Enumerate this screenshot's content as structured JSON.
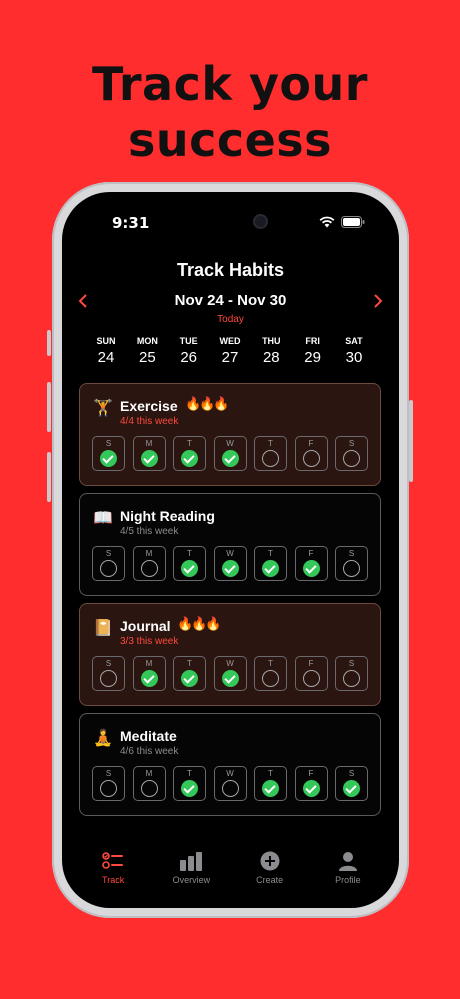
{
  "headline": {
    "line1": "Track your",
    "line2": "success"
  },
  "status": {
    "time": "9:31"
  },
  "screen_title": "Track Habits",
  "week": {
    "range": "Nov 24 - Nov 30",
    "today_label": "Today"
  },
  "days": [
    {
      "name": "SUN",
      "num": "24"
    },
    {
      "name": "MON",
      "num": "25"
    },
    {
      "name": "TUE",
      "num": "26"
    },
    {
      "name": "WED",
      "num": "27"
    },
    {
      "name": "THU",
      "num": "28"
    },
    {
      "name": "FRI",
      "num": "29"
    },
    {
      "name": "SAT",
      "num": "30"
    }
  ],
  "day_letters": [
    "S",
    "M",
    "T",
    "W",
    "T",
    "F",
    "S"
  ],
  "habits": [
    {
      "icon": "🏋",
      "name": "Exercise",
      "flames": "🔥🔥🔥",
      "subtitle": "4/4 this week",
      "checked": [
        true,
        true,
        true,
        true,
        false,
        false,
        false
      ]
    },
    {
      "icon": "📖",
      "name": "Night Reading",
      "flames": "",
      "subtitle": "4/5 this week",
      "checked": [
        false,
        false,
        true,
        true,
        true,
        true,
        false
      ]
    },
    {
      "icon": "📔",
      "name": "Journal",
      "flames": "🔥🔥🔥",
      "subtitle": "3/3 this week",
      "checked": [
        false,
        true,
        true,
        true,
        false,
        false,
        false
      ]
    },
    {
      "icon": "🧘",
      "name": "Meditate",
      "flames": "",
      "subtitle": "4/6 this week",
      "checked": [
        false,
        false,
        true,
        false,
        true,
        true,
        true
      ]
    }
  ],
  "tabs": [
    {
      "label": "Track",
      "icon": "list-check-icon",
      "active": true
    },
    {
      "label": "Overview",
      "icon": "bar-chart-icon",
      "active": false
    },
    {
      "label": "Create",
      "icon": "plus-circle-icon",
      "active": false
    },
    {
      "label": "Profile",
      "icon": "person-icon",
      "active": false
    }
  ],
  "colors": {
    "background": "#ff2d2d",
    "accent": "#ff4a3d",
    "check": "#34c759"
  }
}
